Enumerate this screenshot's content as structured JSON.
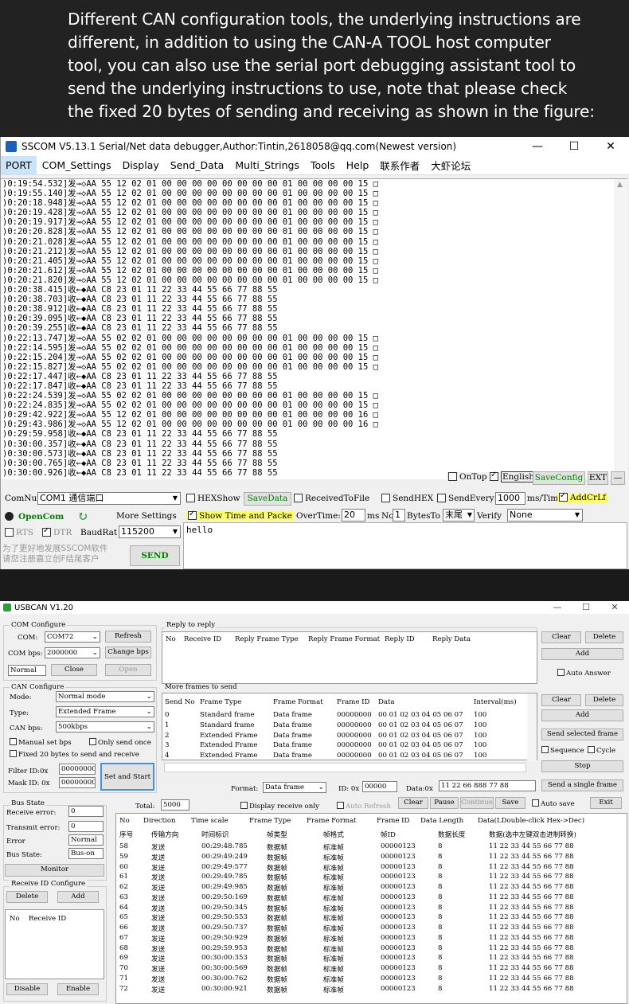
{
  "banner": {
    "lines": [
      "Different CAN configuration tools, the underlying instructions are",
      "different, in addition to using the CAN-A TOOL host computer",
      "tool, you can also use the serial port debugging assistant tool to",
      "send the underlying instructions to use, note that please check",
      "the fixed 20 bytes of sending and receiving as shown in the figure:"
    ]
  },
  "sscom": {
    "title": "SSCOM V5.13.1 Serial/Net data debugger,Author:Tintin,2618058@qq.com(Newest version)",
    "window_buttons": [
      "—",
      "☐",
      "✕"
    ],
    "menu": [
      "PORT",
      "COM_Settings",
      "Display",
      "Send_Data",
      "Multi_Strings",
      "Tools",
      "Help",
      "联系作者",
      "大虾论坛"
    ],
    "log": [
      ")0:19:54.532]发→◇AA 55 12 02 01 00 00 00 00 00 00 00 00 01 00 00 00 00 15 □",
      ")0:19:55.140]发→◇AA 55 12 02 01 00 00 00 00 00 00 00 00 01 00 00 00 00 15 □",
      ")0:20:18.948]发→◇AA 55 12 02 01 00 00 00 00 00 00 00 00 01 00 00 00 00 15 □",
      ")0:20:19.428]发→◇AA 55 12 02 01 00 00 00 00 00 00 00 00 01 00 00 00 00 15 □",
      ")0:20:19.917]发→◇AA 55 12 02 01 00 00 00 00 00 00 00 00 01 00 00 00 00 15 □",
      ")0:20:20.828]发→◇AA 55 12 02 01 00 00 00 00 00 00 00 00 01 00 00 00 00 15 □",
      ")0:20:21.028]发→◇AA 55 12 02 01 00 00 00 00 00 00 00 00 01 00 00 00 00 15 □",
      ")0:20:21.212]发→◇AA 55 12 02 01 00 00 00 00 00 00 00 00 01 00 00 00 00 15 □",
      ")0:20:21.405]发→◇AA 55 12 02 01 00 00 00 00 00 00 00 00 01 00 00 00 00 15 □",
      ")0:20:21.612]发→◇AA 55 12 02 01 00 00 00 00 00 00 00 00 01 00 00 00 00 15 □",
      ")0:20:21.820]发→◇AA 55 12 02 01 00 00 00 00 00 00 00 00 01 00 00 00 00 15 □",
      ")0:20:38.415]收←◆AA C8 23 01 11 22 33 44 55 66 77 88 55",
      ")0:20:38.703]收←◆AA C8 23 01 11 22 33 44 55 66 77 88 55",
      ")0:20:38.912]收←◆AA C8 23 01 11 22 33 44 55 66 77 88 55",
      ")0:20:39.095]收←◆AA C8 23 01 11 22 33 44 55 66 77 88 55",
      ")0:20:39.255]收←◆AA C8 23 01 11 22 33 44 55 66 77 88 55",
      ")0:22:13.747]发→◇AA 55 02 02 01 00 00 00 00 00 00 00 00 01 00 00 00 00 15 □",
      ")0:22:14.595]发→◇AA 55 02 02 01 00 00 00 00 00 00 00 00 01 00 00 00 00 15 □",
      ")0:22:15.204]发→◇AA 55 02 02 01 00 00 00 00 00 00 00 00 01 00 00 00 00 15 □",
      ")0:22:15.827]发→◇AA 55 02 02 01 00 00 00 00 00 00 00 00 01 00 00 00 00 15 □",
      ")0:22:17.447]收←◆AA C8 23 01 11 22 33 44 55 66 77 88 55",
      ")0:22:17.847]收←◆AA C8 23 01 11 22 33 44 55 66 77 88 55",
      ")0:22:24.539]发→◇AA 55 02 02 01 00 00 00 00 00 00 00 00 01 00 00 00 00 15 □",
      ")0:22:24.835]发→◇AA 55 02 02 01 00 00 00 00 00 00 00 00 01 00 00 00 00 15 □",
      ")0:29:42.922]发→◇AA 55 12 02 01 00 00 00 00 00 00 00 00 01 00 00 00 00 16 □",
      ")0:29:43.986]发→◇AA 55 12 02 01 00 00 00 00 00 00 00 00 01 00 00 00 00 16 □",
      ")0:29:59.958]收←◆AA C8 23 01 11 22 33 44 55 66 77 88 55",
      ")0:30:00.357]收←◆AA C8 23 01 11 22 33 44 55 66 77 88 55",
      ")0:30:00.573]收←◆AA C8 23 01 11 22 33 44 55 66 77 88 55",
      ")0:30:00.765]收←◆AA C8 23 01 11 22 33 44 55 66 77 88 55",
      ")0:30:00.926]收←◆AA C8 23 01 11 22 33 44 55 66 77 88 55"
    ],
    "ontop_label": "OnTop",
    "english_label": "English",
    "saveconfig_label": "SaveConfig",
    "ext_label": "EXT",
    "dash_label": "—",
    "comnum_label": "ComNum",
    "com_value": "COM1 通信端口",
    "hexshow_label": "HEXShow",
    "savedata_label": "SaveData",
    "receivedtofile_label": "ReceivedToFile",
    "sendhex_label": "SendHEX",
    "sendevery_label": "SendEvery:",
    "sendevery_value": "1000",
    "sendevery_unit": "ms/Tim",
    "addcrlf_label": "AddCrLf",
    "opencom_label": "OpenCom",
    "more_settings_label": "More Settings",
    "show_time_label": "Show Time and Packe",
    "overtime_label": "OverTime:",
    "overtime_value": "20",
    "overtime_unit": "ms",
    "no_label": "No",
    "no_value": "1",
    "bytesto_label": "BytesTo",
    "bytesto_value": "末尾",
    "verify_label": "Verify",
    "verify_value": "None",
    "rts_label": "RTS",
    "dtr_label": "DTR",
    "baudrate_label": "BaudRat",
    "baudrate_value": "115200",
    "send_text": "hello",
    "promo_line1": "为了更好地发展SSCOM软件",
    "promo_line2": "请您注册嘉立创F结尾客户",
    "send_button": "SEND"
  },
  "usbcan": {
    "title": "USBCAN V1.20",
    "window_buttons": [
      "—",
      "☐",
      "✕"
    ],
    "com_configure": "COM Configure",
    "com_label": "COM:",
    "com_value": "COM72",
    "refresh": "Refresh",
    "combps_label": "COM bps:",
    "combps_value": "2000000",
    "change_bps": "Change bps",
    "normal_value": "Normal",
    "close": "Close",
    "open": "Open",
    "can_configure": "CAN Configure",
    "mode_label": "Mode:",
    "mode_value": "Normal mode",
    "type_label": "Type:",
    "type_value": "Extended Frame",
    "canbps_label": "CAN bps:",
    "canbps_value": "500kbps",
    "manual_set_bps": "Manual set bps",
    "only_send_once": "Only send once",
    "fixed20": "Fixed 20 bytes to send and receive",
    "filter_label": "Filter ID:0x",
    "filter_value": "00000000",
    "mask_label": "Mask ID:  0x",
    "mask_value": "00000000",
    "set_and_start": "Set and Start",
    "reply_to_reply": "Reply to reply",
    "reply_headers": [
      "No",
      "Receive ID",
      "Reply Frame Type",
      "Reply Frame Format",
      "Reply  ID",
      "Reply Data"
    ],
    "reply_clear": "Clear",
    "reply_delete": "Delete",
    "reply_add": "Add",
    "auto_answer": "Auto Answer",
    "more_frames": "More frames to send",
    "send_headers": [
      "Send No",
      "Frame Type",
      "Frame Format",
      "Frame ID",
      "Data",
      "Interval(ms)"
    ],
    "send_rows": [
      [
        "0",
        "Standard frame",
        "Data frame",
        "00000000",
        "00 01 02 03 04 05 06 07",
        "100"
      ],
      [
        "1",
        "Standard frame",
        "Data frame",
        "00000000",
        "00 01 02 03 04 05 06 07",
        "100"
      ],
      [
        "2",
        "Extended Frame",
        "Data frame",
        "00000000",
        "00 01 02 03 04 05 06 07",
        "100"
      ],
      [
        "3",
        "Extended Frame",
        "Data frame",
        "00000000",
        "00 01 02 03 04 05 06 07",
        "100"
      ],
      [
        "4",
        "Extended Frame",
        "Data frame",
        "00000000",
        "00 01 02 03 04 05 06 07",
        "100"
      ]
    ],
    "send_clear": "Clear",
    "send_delete": "Delete",
    "send_add": "Add",
    "send_selected": "Send selected frame",
    "sequence": "Sequence",
    "cycle": "Cycle",
    "stop": "Stop",
    "format_label": "Format:",
    "format_value": "Data frame",
    "id_label": "ID: 0x",
    "id_value": "00000",
    "data_label": "Data:0x",
    "data_value": "11 22 66 888 77 88",
    "send_single": "Send a single frame",
    "bus_state_group": "Bus State",
    "receive_error_label": "Receive error:",
    "receive_error_value": "0",
    "transmit_error_label": "Transmit error:",
    "transmit_error_value": "0",
    "error_label": "Error",
    "error_value": "Normal",
    "bus_state_label": "Bus State:",
    "bus_state_value": "Bus-on",
    "monitor": "Monitor",
    "receive_id_configure": "Receive ID Configure",
    "rid_delete": "Delete",
    "rid_add": "Add",
    "rid_headers": [
      "No",
      "Receive ID"
    ],
    "disable": "Disable",
    "enable": "Enable",
    "total_label": "Total:",
    "total_value": "5000",
    "display_receive_only": "Display receive only",
    "auto_refresh": "Auto Refresh",
    "log_clear": "Clear",
    "pause": "Pause",
    "continue": "Continue",
    "save": "Save",
    "auto_save": "Auto save",
    "exit": "Exit",
    "log_headers_en": [
      "No",
      "Direction",
      "Time scale",
      "Frame Type",
      "Frame Format",
      "Frame ID",
      "Data Length",
      "Data(LDouble-click Hex->Dec)"
    ],
    "log_headers_cn": [
      "序号",
      "传输方向",
      "时间标识",
      "帧类型",
      "帧格式",
      "帧ID",
      "数据长度",
      "数据(选中左键双击进制转换)"
    ],
    "log_rows": [
      [
        "58",
        "发送",
        "00:29:48:785",
        "数据帧",
        "标准帧",
        "00000123",
        "8",
        "11 22 33 44 55 66 77 88"
      ],
      [
        "59",
        "发送",
        "00:29:49:249",
        "数据帧",
        "标准帧",
        "00000123",
        "8",
        "11 22 33 44 55 66 77 88"
      ],
      [
        "60",
        "发送",
        "00:29:49:577",
        "数据帧",
        "标准帧",
        "00000123",
        "8",
        "11 22 33 44 55 66 77 88"
      ],
      [
        "61",
        "发送",
        "00:29:49:785",
        "数据帧",
        "标准帧",
        "00000123",
        "8",
        "11 22 33 44 55 66 77 88"
      ],
      [
        "62",
        "发送",
        "00:29:49:985",
        "数据帧",
        "标准帧",
        "00000123",
        "8",
        "11 22 33 44 55 66 77 88"
      ],
      [
        "63",
        "发送",
        "00:29:50:169",
        "数据帧",
        "标准帧",
        "00000123",
        "8",
        "11 22 33 44 55 66 77 88"
      ],
      [
        "64",
        "发送",
        "00:29:50:345",
        "数据帧",
        "标准帧",
        "00000123",
        "8",
        "11 22 33 44 55 66 77 88"
      ],
      [
        "65",
        "发送",
        "00:29:50:553",
        "数据帧",
        "标准帧",
        "00000123",
        "8",
        "11 22 33 44 55 66 77 88"
      ],
      [
        "66",
        "发送",
        "00:29:50:737",
        "数据帧",
        "标准帧",
        "00000123",
        "8",
        "11 22 33 44 55 66 77 88"
      ],
      [
        "67",
        "发送",
        "00:29:50:929",
        "数据帧",
        "标准帧",
        "00000123",
        "8",
        "11 22 33 44 55 66 77 88"
      ],
      [
        "68",
        "发送",
        "00:29:59.953",
        "数据帧",
        "标准帧",
        "00000123",
        "8",
        "11 22 33 44 55 66 77 88"
      ],
      [
        "69",
        "发送",
        "00:30:00:353",
        "数据帧",
        "标准帧",
        "00000123",
        "8",
        "11 22 33 44 55 66 77 88"
      ],
      [
        "70",
        "发送",
        "00:30:00:569",
        "数据帧",
        "标准帧",
        "00000123",
        "8",
        "11 22 33 44 55 66 77 88"
      ],
      [
        "71",
        "发送",
        "00:30:00:762",
        "数据帧",
        "标准帧",
        "00000123",
        "8",
        "11 22 33 44 55 66 77 88"
      ],
      [
        "72",
        "发送",
        "00:30:00:921",
        "数据帧",
        "标准帧",
        "00000123",
        "8",
        "11 22 33 44 55 66 77 88"
      ]
    ]
  }
}
